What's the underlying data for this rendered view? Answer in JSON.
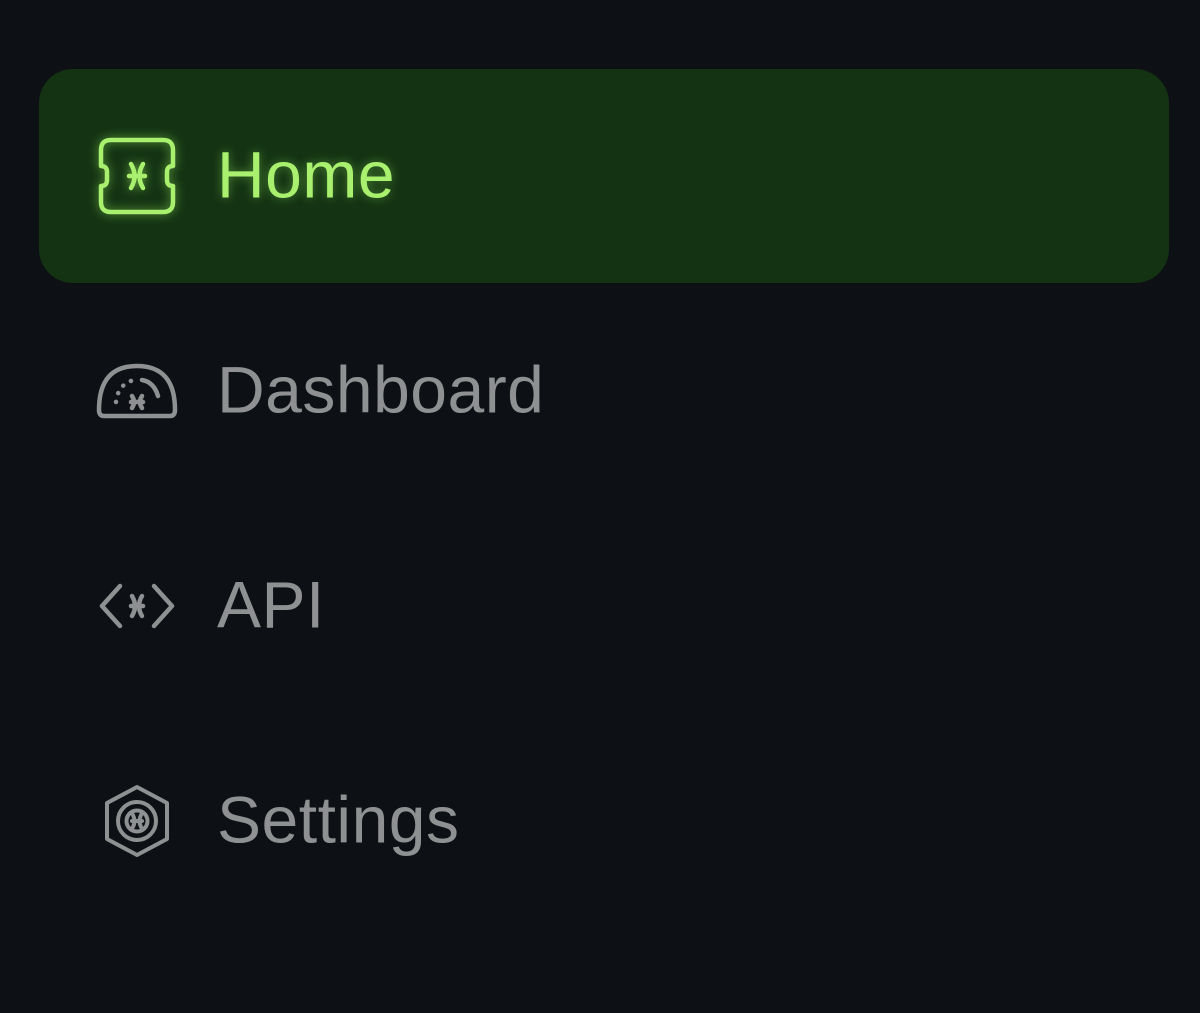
{
  "nav": {
    "items": [
      {
        "label": "Home",
        "icon": "home-logo-icon",
        "active": true
      },
      {
        "label": "Dashboard",
        "icon": "gauge-icon",
        "active": false
      },
      {
        "label": "API",
        "icon": "code-brackets-icon",
        "active": false
      },
      {
        "label": "Settings",
        "icon": "hexagon-settings-icon",
        "active": false
      }
    ]
  },
  "colors": {
    "background": "#0d1115",
    "active_background": "#143313",
    "active_accent": "#a8f06e",
    "inactive_text": "#8e9092"
  }
}
